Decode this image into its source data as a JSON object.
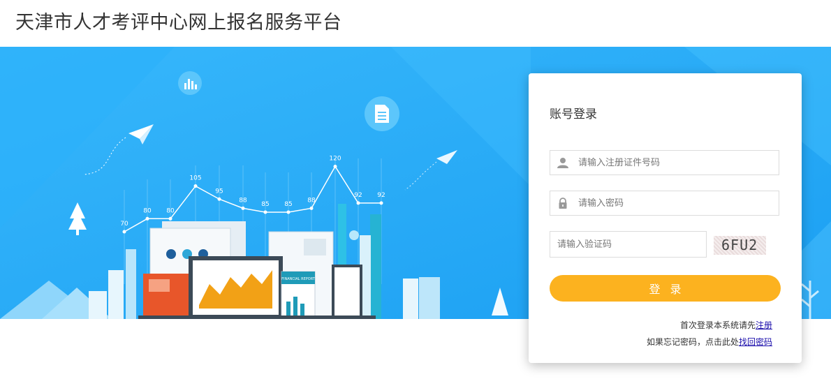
{
  "header": {
    "title": "天津市人才考评中心网上报名服务平台"
  },
  "banner": {
    "chart_labels": [
      "70",
      "80",
      "80",
      "105",
      "95",
      "88",
      "85",
      "85",
      "88",
      "120",
      "92",
      "92"
    ],
    "report_caption": "FINANCIAL REPORT"
  },
  "login": {
    "title": "账号登录",
    "id_placeholder": "请输入注册证件号码",
    "password_placeholder": "请输入密码",
    "captcha_placeholder": "请输入验证码",
    "captcha_text": "6FU2",
    "button_label": "登录",
    "register_prefix": "首次登录本系统请先",
    "register_link": "注册",
    "forgot_prefix": "如果忘记密码，点击此处",
    "forgot_link": "找回密码"
  },
  "colors": {
    "banner_blue": "#22a8f6",
    "button_orange": "#fcb21f",
    "link_blue": "#1a0dab"
  },
  "icons": [
    "bar-chart-icon",
    "document-icon",
    "paper-plane-icon",
    "user-icon",
    "lock-icon",
    "tree-icon"
  ]
}
